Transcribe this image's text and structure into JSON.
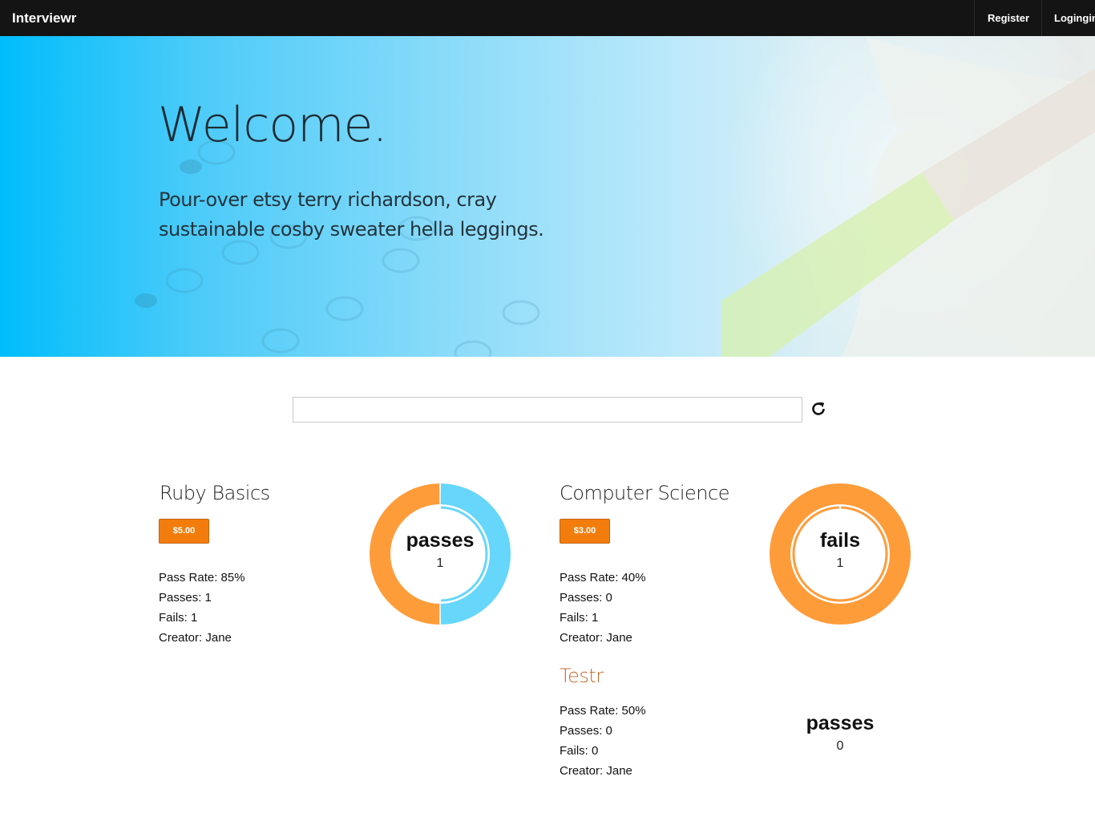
{
  "navbar": {
    "brand": "Interviewr",
    "register": "Register",
    "login": "Logingin"
  },
  "hero": {
    "title": "Welcome.",
    "subtitle": "Pour-over etsy terry richardson, cray sustainable cosby sweater hella leggings."
  },
  "search": {
    "value": "",
    "placeholder": ""
  },
  "colors": {
    "accent_orange": "#f27d0c",
    "donut_orange": "#ff9c3a",
    "donut_blue": "#66d6fb",
    "navbar": "#141414"
  },
  "tests": [
    {
      "title": "Ruby Basics",
      "price": "$5.00",
      "pass_rate": "Pass Rate: 85%",
      "passes": "Passes: 1",
      "fails": "Fails: 1",
      "creator": "Creator: Jane",
      "chart_label": "passes",
      "chart_count": "1",
      "chart_values": {
        "passes": 1,
        "fails": 1
      }
    },
    {
      "title": "Computer Science",
      "price": "$3.00",
      "pass_rate": "Pass Rate: 40%",
      "passes": "Passes: 0",
      "fails": "Fails: 1",
      "creator": "Creator: Jane",
      "chart_label": "fails",
      "chart_count": "1",
      "chart_values": {
        "passes": 0,
        "fails": 1
      }
    },
    {
      "title": "Testr",
      "pass_rate": "Pass Rate: 50%",
      "passes": "Passes: 0",
      "fails": "Fails: 0",
      "creator": "Creator: Jane",
      "chart_label": "passes",
      "chart_count": "0",
      "chart_values": {
        "passes": 0,
        "fails": 0
      }
    }
  ],
  "icons": {
    "refresh": "refresh-icon"
  }
}
